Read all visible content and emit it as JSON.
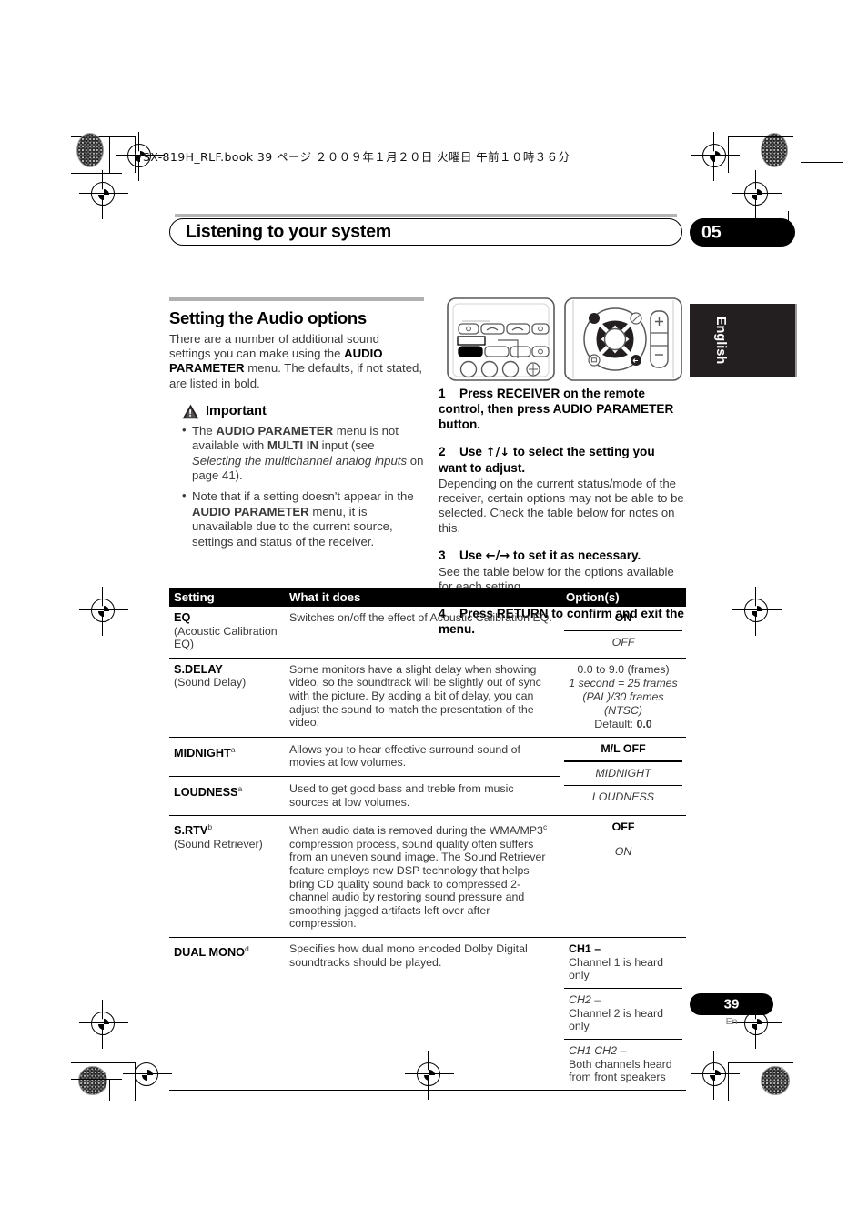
{
  "print_header": "VSX-819H_RLF.book   39 ページ   ２００９年１月２０日   火曜日   午前１０時３６分",
  "chapter": {
    "title": "Listening to your system",
    "number": "05"
  },
  "language_tab": "English",
  "section": {
    "heading": "Setting the Audio options",
    "intro_1": "There are a number of additional sound settings you can make using the ",
    "intro_bold_1": "AUDIO PARAMETER",
    "intro_2": " menu. The defaults, if not stated, are listed in bold."
  },
  "important": {
    "label": "Important",
    "bullets": [
      {
        "p1": "The ",
        "b1": "AUDIO PARAMETER",
        "p2": " menu is not available with ",
        "b2": "MULTI IN",
        "p3": " input (see ",
        "i1": "Selecting the multichannel analog inputs",
        "p4": " on page 41)."
      },
      {
        "p1": "Note that if a setting doesn't appear in the ",
        "b1": "AUDIO PARAMETER",
        "p2": " menu, it is unavailable due to the current source, settings and status of the receiver.",
        "b2": "",
        "p3": "",
        "i1": "",
        "p4": ""
      }
    ]
  },
  "steps": [
    {
      "num": "1",
      "bold": "Press RECEIVER on the remote control, then press AUDIO PARAMETER button.",
      "sub": ""
    },
    {
      "num": "2",
      "bold_pre": "Use ",
      "arrows": "↑/↓",
      "bold_post": " to select the setting you want to adjust.",
      "sub": "Depending on the current status/mode of the receiver, certain options may not be able to be selected. Check the table below for notes on this."
    },
    {
      "num": "3",
      "bold_pre": "Use ",
      "arrows": "←/→",
      "bold_post": " to set it as necessary.",
      "sub": "See the table below for the options available for each setting."
    },
    {
      "num": "4",
      "bold": "Press RETURN to confirm and exit the menu.",
      "sub": ""
    }
  ],
  "table": {
    "headers": {
      "setting": "Setting",
      "what": "What it does",
      "options": "Option(s)"
    },
    "rows": {
      "eq": {
        "name": "EQ",
        "sub": "(Acoustic Calibration EQ)",
        "what": "Switches on/off the effect of Acoustic Calibration EQ.",
        "opt1": "ON",
        "opt2": "OFF"
      },
      "sdelay": {
        "name": "S.DELAY",
        "sub": "(Sound Delay)",
        "what": "Some monitors have a slight delay when showing video, so the soundtrack will be slightly out of sync with the picture. By adding a bit of delay, you can adjust the sound to match the presentation of the video.",
        "opt1": "0.0 to 9.0 (frames)",
        "opt2": "1 second = 25 frames (PAL)/30 frames (NTSC)",
        "opt3_pre": "Default: ",
        "opt3_bold": "0.0"
      },
      "midnight": {
        "name": "MIDNIGHT",
        "sup": "a",
        "what": "Allows you to hear effective surround sound of movies at low volumes."
      },
      "loudness": {
        "name": "LOUDNESS",
        "sup": "a",
        "what": "Used to get good bass and treble from music sources at low volumes."
      },
      "ml_options": {
        "opt1": "M/L OFF",
        "opt2": "MIDNIGHT",
        "opt3": "LOUDNESS"
      },
      "srtv": {
        "name": "S.RTV",
        "sup": "b",
        "sub": "(Sound Retriever)",
        "what_pre": "When audio data is removed during the WMA/MP3",
        "what_sup": "c",
        "what_post": " compression process, sound quality often suffers from an uneven sound image. The Sound Retriever feature employs new DSP technology that helps bring CD quality sound back to compressed 2-channel audio by restoring sound pressure and smoothing jagged artifacts left over after compression.",
        "opt1": "OFF",
        "opt2": "ON"
      },
      "dualmono": {
        "name": "DUAL MONO",
        "sup": "d",
        "what": "Specifies how dual mono encoded Dolby Digital soundtracks should be played.",
        "opt1_bold": "CH1 –",
        "opt1_desc": "Channel 1 is heard only",
        "opt2_ital": "CH2 –",
        "opt2_desc": "Channel 2 is heard only",
        "opt3_ital": "CH1 CH2 –",
        "opt3_desc": "Both channels heard from front speakers"
      }
    }
  },
  "footer": {
    "page": "39",
    "lang": "En"
  }
}
